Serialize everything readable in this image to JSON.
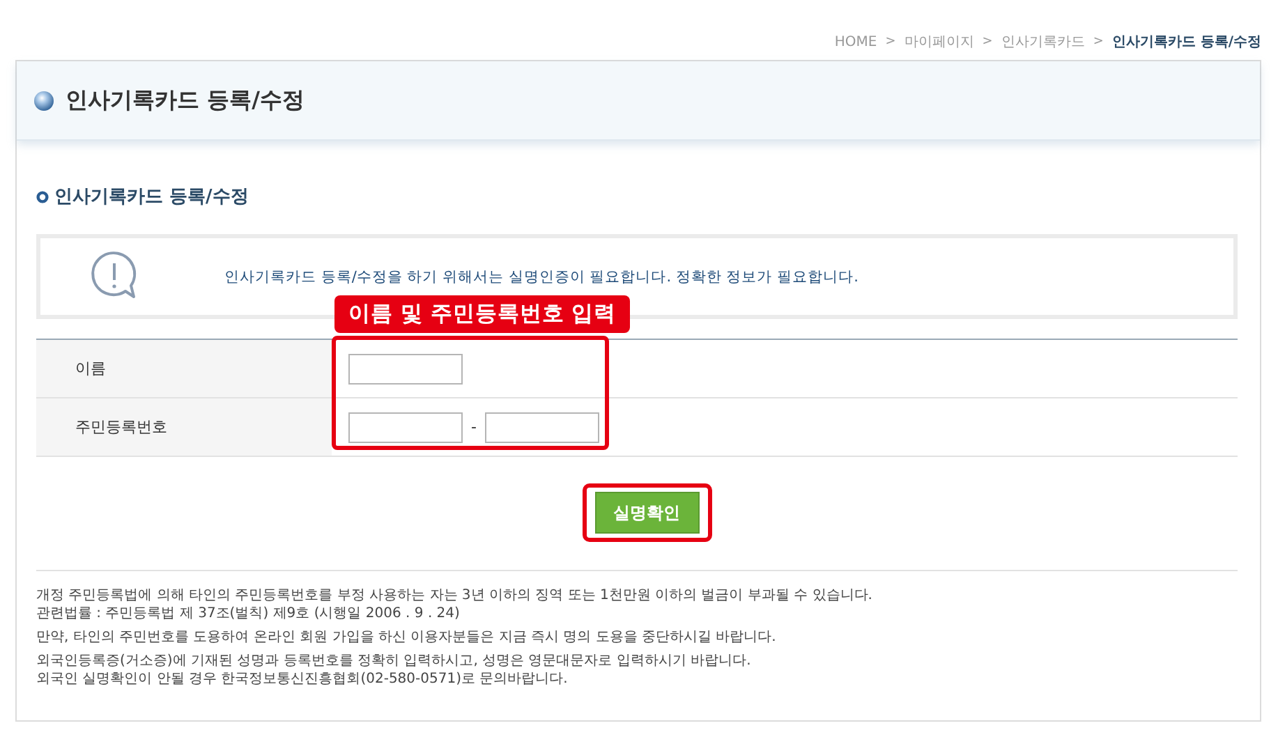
{
  "breadcrumb": [
    {
      "label": "HOME",
      "current": false
    },
    {
      "label": "마이페이지",
      "current": false
    },
    {
      "label": "인사기록카드",
      "current": false
    },
    {
      "label": "인사기록카드 등록/수정",
      "current": true
    }
  ],
  "breadcrumb_separator": ">",
  "page_title": "인사기록카드 등록/수정",
  "section_title": "인사기록카드 등록/수정",
  "notice": "인사기록카드 등록/수정을 하기 위해서는 실명인증이 필요합니다. 정확한 정보가 필요합니다.",
  "annotation": "이름 및 주민등록번호 입력",
  "form": {
    "rows": [
      {
        "label": "이름",
        "kind": "single"
      },
      {
        "label": "주민등록번호",
        "kind": "split",
        "separator": "-"
      }
    ]
  },
  "submit_button": "실명확인",
  "notes": [
    [
      "개정 주민등록법에 의해 타인의 주민등록번호를 부정 사용하는 자는 3년 이하의 징역 또는 1천만원 이하의 벌금이 부과될 수 있습니다.",
      "관련법률 : 주민등록법 제 37조(벌칙) 제9호 (시행일 2006 . 9 . 24)"
    ],
    [
      "만약, 타인의 주민번호를 도용하여 온라인 회원 가입을 하신 이용자분들은 지금 즉시 명의 도용을 중단하시길 바랍니다."
    ],
    [
      "외국인등록증(거소증)에 기재된 성명과 등록번호를 정확히 입력하시고, 성명은 영문대문자로 입력하시기 바랍니다.",
      "외국인 실명확인이 안될 경우 한국정보통신진흥협회(02-580-0571)로 문의바랍니다."
    ]
  ]
}
